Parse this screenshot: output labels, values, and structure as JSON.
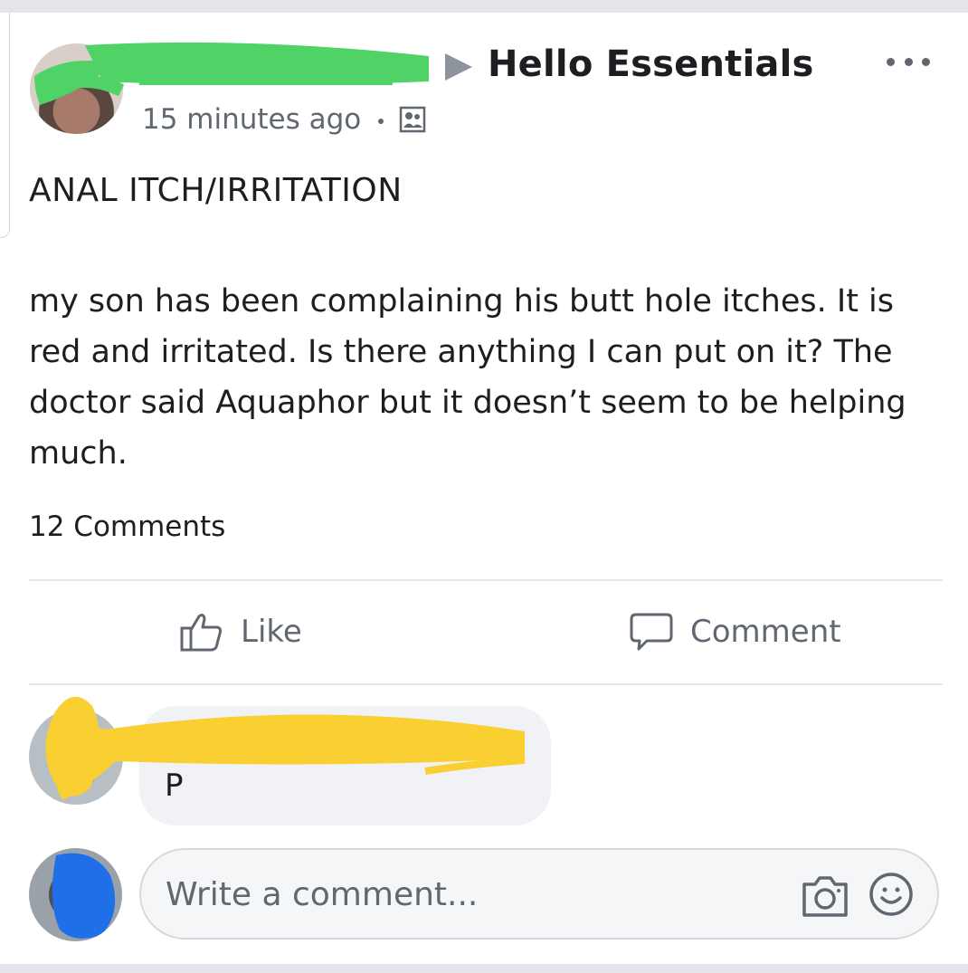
{
  "post": {
    "author_name": "",
    "group_name": "Hello Essentials",
    "timestamp": "15 minutes ago",
    "privacy_icon": "group-members-icon",
    "more_icon": "more-options-icon",
    "title": "ANAL ITCH/IRRITATION",
    "body": "my son has been complaining his butt hole itches. It is red and irritated. Is there anything I can put on it? The doctor said Aquaphor but it doesn’t seem to be helping much.",
    "comment_count": "12 Comments"
  },
  "actions": {
    "like_label": "Like",
    "comment_label": "Comment"
  },
  "comments": [
    {
      "author": "",
      "text": "P"
    }
  ],
  "composer": {
    "placeholder": "Write a comment...",
    "camera_icon": "camera-icon",
    "emoji_icon": "smiley-icon"
  },
  "colors": {
    "author_redaction": "#4fd266",
    "commenter_redaction": "#f9cf32",
    "composer_avatar_redaction": "#1f6fe8",
    "secondary_text": "#606770"
  }
}
